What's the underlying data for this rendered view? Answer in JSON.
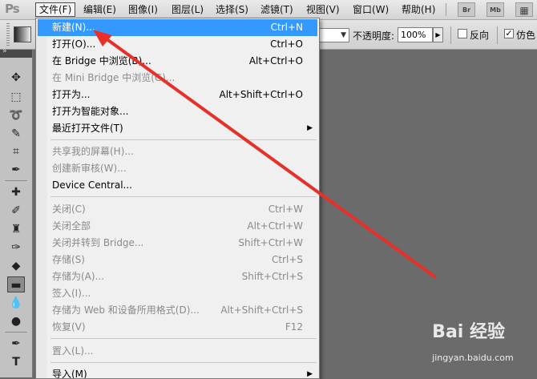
{
  "app": {
    "logo": "Ps"
  },
  "menubar": {
    "items": [
      "文件(F)",
      "编辑(E)",
      "图像(I)",
      "图层(L)",
      "选择(S)",
      "滤镜(T)",
      "视图(V)",
      "窗口(W)",
      "帮助(H)"
    ],
    "bridge_btn": "Br",
    "minibridge_btn": "Mb"
  },
  "options": {
    "opacity_label": "不透明度:",
    "opacity_value": "100%",
    "reverse_label": "反向",
    "reverse_checked": false,
    "dither_label": "仿色",
    "dither_checked": true,
    "check_mark": "✓"
  },
  "tools_panel": {
    "collapse_glyph": "»"
  },
  "file_menu": {
    "items": [
      {
        "label": "新建(N)...",
        "shortcut": "Ctrl+N",
        "highlighted": true,
        "disabled": false
      },
      {
        "label": "打开(O)...",
        "shortcut": "Ctrl+O",
        "disabled": false
      },
      {
        "label": "在 Bridge 中浏览(B)...",
        "shortcut": "Alt+Ctrl+O",
        "disabled": false
      },
      {
        "label": "在 Mini Bridge 中浏览(G)...",
        "shortcut": "",
        "disabled": true
      },
      {
        "label": "打开为...",
        "shortcut": "Alt+Shift+Ctrl+O",
        "disabled": false
      },
      {
        "label": "打开为智能对象...",
        "shortcut": "",
        "disabled": false
      },
      {
        "label": "最近打开文件(T)",
        "shortcut": "",
        "submenu": true,
        "disabled": false
      },
      {
        "label": "共享我的屏幕(H)...",
        "shortcut": "",
        "disabled": true
      },
      {
        "label": "创建新审核(W)...",
        "shortcut": "",
        "disabled": true
      },
      {
        "label": "Device Central...",
        "shortcut": "",
        "disabled": false
      },
      {
        "label": "关闭(C)",
        "shortcut": "Ctrl+W",
        "disabled": true
      },
      {
        "label": "关闭全部",
        "shortcut": "Alt+Ctrl+W",
        "disabled": true
      },
      {
        "label": "关闭并转到 Bridge...",
        "shortcut": "Shift+Ctrl+W",
        "disabled": true
      },
      {
        "label": "存储(S)",
        "shortcut": "Ctrl+S",
        "disabled": true
      },
      {
        "label": "存储为(A)...",
        "shortcut": "Shift+Ctrl+S",
        "disabled": true
      },
      {
        "label": "签入(I)...",
        "shortcut": "",
        "disabled": true
      },
      {
        "label": "存储为 Web 和设备所用格式(D)...",
        "shortcut": "Alt+Shift+Ctrl+S",
        "disabled": true
      },
      {
        "label": "恢复(V)",
        "shortcut": "F12",
        "disabled": true
      },
      {
        "label": "置入(L)...",
        "shortcut": "",
        "disabled": true
      },
      {
        "label": "导入(M)",
        "shortcut": "",
        "submenu": true,
        "disabled": false
      }
    ],
    "submenu_glyph": "▶"
  },
  "watermark": {
    "logo": "Bai  经验",
    "url": "jingyan.baidu.com"
  },
  "colors": {
    "highlight": "#3399ff",
    "arrow": "#e8302a"
  }
}
